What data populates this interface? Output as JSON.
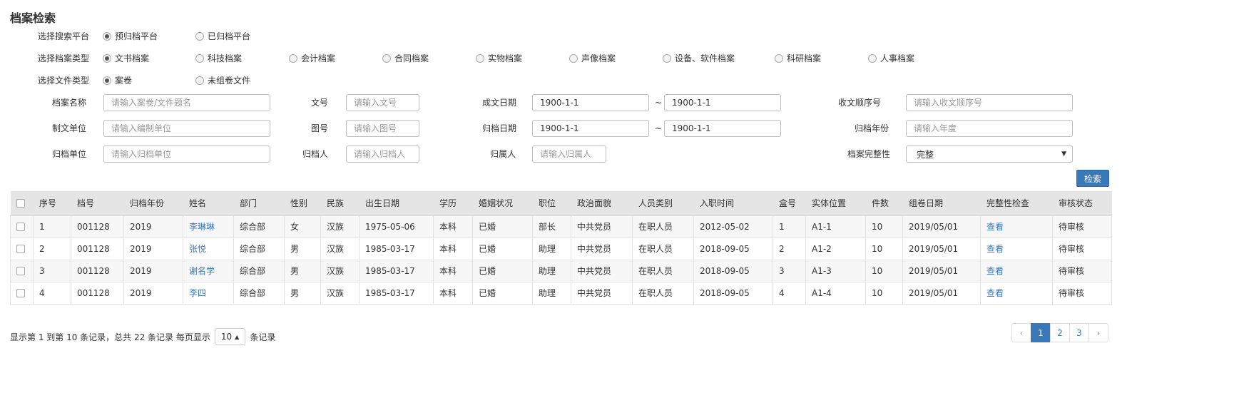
{
  "title": "档案检索",
  "platform": {
    "label": "选择搜索平台",
    "options": [
      {
        "label": "预归档平台",
        "checked": true
      },
      {
        "label": "已归档平台",
        "checked": false
      }
    ]
  },
  "archive_type": {
    "label": "选择档案类型",
    "options": [
      {
        "label": "文书档案",
        "checked": true
      },
      {
        "label": "科技档案",
        "checked": false
      },
      {
        "label": "会计档案",
        "checked": false
      },
      {
        "label": "合同档案",
        "checked": false
      },
      {
        "label": "实物档案",
        "checked": false
      },
      {
        "label": "声像档案",
        "checked": false
      },
      {
        "label": "设备、软件档案",
        "checked": false
      },
      {
        "label": "科研档案",
        "checked": false
      },
      {
        "label": "人事档案",
        "checked": false
      }
    ]
  },
  "file_type": {
    "label": "选择文件类型",
    "options": [
      {
        "label": "案卷",
        "checked": true
      },
      {
        "label": "未组卷文件",
        "checked": false
      }
    ]
  },
  "fields": {
    "archive_name": {
      "label": "档案名称",
      "placeholder": "请输入案卷/文件题名"
    },
    "doc_no": {
      "label": "文号",
      "placeholder": "请输入文号"
    },
    "create_date": {
      "label": "成文日期",
      "from": "1900-1-1",
      "to": "1900-1-1",
      "sep": "~"
    },
    "receipt_seq": {
      "label": "收文顺序号",
      "placeholder": "请输入收文顺序号"
    },
    "maker_unit": {
      "label": "制文单位",
      "placeholder": "请输入编制单位"
    },
    "figure_no": {
      "label": "图号",
      "placeholder": "请输入图号"
    },
    "archive_date": {
      "label": "归档日期",
      "from": "1900-1-1",
      "to": "1900-1-1",
      "sep": "~"
    },
    "archive_year": {
      "label": "归档年份",
      "placeholder": "请输入年度"
    },
    "archive_unit": {
      "label": "归档单位",
      "placeholder": "请输入归档单位"
    },
    "archiver": {
      "label": "归档人",
      "placeholder": "请输入归档人"
    },
    "owner": {
      "label": "归属人",
      "placeholder": "请输入归属人"
    },
    "completeness": {
      "label": "档案完整性",
      "value": "完整"
    }
  },
  "search_button": "检索",
  "table": {
    "headers": [
      "序号",
      "档号",
      "归档年份",
      "姓名",
      "部门",
      "性别",
      "民族",
      "出生日期",
      "学历",
      "婚姻状况",
      "职位",
      "政治面貌",
      "人员类别",
      "入职时间",
      "盒号",
      "实体位置",
      "件数",
      "组卷日期",
      "完整性检查",
      "审核状态"
    ],
    "rows": [
      [
        "1",
        "001128",
        "2019",
        "李琳琳",
        "综合部",
        "女",
        "汉族",
        "1975-05-06",
        "本科",
        "已婚",
        "部长",
        "中共党员",
        "在职人员",
        "2012-05-02",
        "1",
        "A1-1",
        "10",
        "2019/05/01",
        "查看",
        "待审核"
      ],
      [
        "2",
        "001128",
        "2019",
        "张悦",
        "综合部",
        "男",
        "汉族",
        "1985-03-17",
        "本科",
        "已婚",
        "助理",
        "中共党员",
        "在职人员",
        "2018-09-05",
        "2",
        "A1-2",
        "10",
        "2019/05/01",
        "查看",
        "待审核"
      ],
      [
        "3",
        "001128",
        "2019",
        "谢名学",
        "综合部",
        "男",
        "汉族",
        "1985-03-17",
        "本科",
        "已婚",
        "助理",
        "中共党员",
        "在职人员",
        "2018-09-05",
        "3",
        "A1-3",
        "10",
        "2019/05/01",
        "查看",
        "待审核"
      ],
      [
        "4",
        "001128",
        "2019",
        "李四",
        "综合部",
        "男",
        "汉族",
        "1985-03-17",
        "本科",
        "已婚",
        "助理",
        "中共党员",
        "在职人员",
        "2018-09-05",
        "4",
        "A1-4",
        "10",
        "2019/05/01",
        "查看",
        "待审核"
      ]
    ]
  },
  "pagination": {
    "info_prefix": "显示第 1 到第 10 条记录，总共 22 条记录 每页显示",
    "page_size": "10",
    "info_suffix": "条记录",
    "prev": "‹",
    "pages": [
      "1",
      "2",
      "3"
    ],
    "active": "1",
    "next": "›"
  }
}
